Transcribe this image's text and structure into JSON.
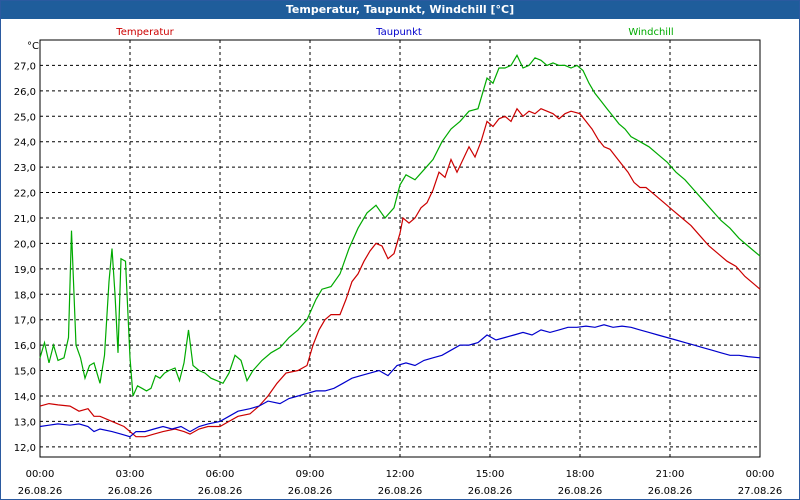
{
  "window": {
    "title": "Temperatur, Taupunkt, Windchill [°C]"
  },
  "chart_data": {
    "type": "line",
    "title": "Temperatur, Taupunkt, Windchill [°C]",
    "ylabel": "°C",
    "ylim": [
      11.6,
      28.0
    ],
    "xlim": [
      0,
      24
    ],
    "y_ticks": [
      "12,0",
      "13,0",
      "14,0",
      "15,0",
      "16,0",
      "17,0",
      "18,0",
      "19,0",
      "20,0",
      "21,0",
      "22,0",
      "23,0",
      "24,0",
      "25,0",
      "26,0",
      "27,0"
    ],
    "x_ticks": [
      {
        "time": "00:00",
        "date": "26.08.26",
        "h": 0
      },
      {
        "time": "03:00",
        "date": "26.08.26",
        "h": 3
      },
      {
        "time": "06:00",
        "date": "26.08.26",
        "h": 6
      },
      {
        "time": "09:00",
        "date": "26.08.26",
        "h": 9
      },
      {
        "time": "12:00",
        "date": "26.08.26",
        "h": 12
      },
      {
        "time": "15:00",
        "date": "26.08.26",
        "h": 15
      },
      {
        "time": "18:00",
        "date": "26.08.26",
        "h": 18
      },
      {
        "time": "21:00",
        "date": "26.08.26",
        "h": 21
      },
      {
        "time": "00:00",
        "date": "27.08.26",
        "h": 24
      }
    ],
    "grid": true,
    "series": [
      {
        "name": "Temperatur",
        "color": "#cc0000",
        "points": [
          [
            0,
            13.6
          ],
          [
            0.3,
            13.7
          ],
          [
            0.6,
            13.65
          ],
          [
            1.0,
            13.6
          ],
          [
            1.3,
            13.4
          ],
          [
            1.6,
            13.5
          ],
          [
            1.8,
            13.2
          ],
          [
            2.0,
            13.2
          ],
          [
            2.4,
            13.0
          ],
          [
            2.8,
            12.8
          ],
          [
            3.0,
            12.6
          ],
          [
            3.2,
            12.4
          ],
          [
            3.5,
            12.4
          ],
          [
            3.8,
            12.5
          ],
          [
            4.1,
            12.6
          ],
          [
            4.5,
            12.7
          ],
          [
            4.8,
            12.6
          ],
          [
            5.0,
            12.5
          ],
          [
            5.3,
            12.7
          ],
          [
            5.6,
            12.8
          ],
          [
            6.0,
            12.8
          ],
          [
            6.3,
            13.0
          ],
          [
            6.6,
            13.2
          ],
          [
            7.0,
            13.3
          ],
          [
            7.3,
            13.6
          ],
          [
            7.6,
            14.0
          ],
          [
            7.9,
            14.5
          ],
          [
            8.2,
            14.9
          ],
          [
            8.6,
            15.0
          ],
          [
            8.9,
            15.2
          ],
          [
            9.1,
            16.0
          ],
          [
            9.3,
            16.6
          ],
          [
            9.5,
            17.0
          ],
          [
            9.7,
            17.2
          ],
          [
            10.0,
            17.2
          ],
          [
            10.2,
            17.8
          ],
          [
            10.4,
            18.5
          ],
          [
            10.6,
            18.8
          ],
          [
            10.8,
            19.3
          ],
          [
            11.0,
            19.7
          ],
          [
            11.2,
            20.0
          ],
          [
            11.4,
            19.9
          ],
          [
            11.6,
            19.4
          ],
          [
            11.8,
            19.6
          ],
          [
            12.0,
            20.4
          ],
          [
            12.1,
            21.0
          ],
          [
            12.3,
            20.8
          ],
          [
            12.5,
            21.0
          ],
          [
            12.7,
            21.4
          ],
          [
            12.9,
            21.6
          ],
          [
            13.1,
            22.1
          ],
          [
            13.3,
            22.8
          ],
          [
            13.5,
            22.6
          ],
          [
            13.7,
            23.3
          ],
          [
            13.9,
            22.8
          ],
          [
            14.1,
            23.3
          ],
          [
            14.3,
            23.8
          ],
          [
            14.5,
            23.4
          ],
          [
            14.7,
            24.0
          ],
          [
            14.9,
            24.8
          ],
          [
            15.1,
            24.6
          ],
          [
            15.3,
            24.9
          ],
          [
            15.5,
            25.0
          ],
          [
            15.7,
            24.8
          ],
          [
            15.9,
            25.3
          ],
          [
            16.1,
            25.0
          ],
          [
            16.3,
            25.2
          ],
          [
            16.5,
            25.1
          ],
          [
            16.7,
            25.3
          ],
          [
            16.9,
            25.2
          ],
          [
            17.1,
            25.1
          ],
          [
            17.3,
            24.9
          ],
          [
            17.5,
            25.1
          ],
          [
            17.7,
            25.2
          ],
          [
            18.0,
            25.1
          ],
          [
            18.2,
            24.8
          ],
          [
            18.4,
            24.5
          ],
          [
            18.6,
            24.1
          ],
          [
            18.8,
            23.8
          ],
          [
            19.0,
            23.7
          ],
          [
            19.2,
            23.4
          ],
          [
            19.4,
            23.1
          ],
          [
            19.6,
            22.8
          ],
          [
            19.8,
            22.4
          ],
          [
            20.0,
            22.2
          ],
          [
            20.2,
            22.2
          ],
          [
            20.5,
            21.9
          ],
          [
            20.8,
            21.6
          ],
          [
            21.1,
            21.3
          ],
          [
            21.4,
            21.0
          ],
          [
            21.7,
            20.7
          ],
          [
            22.0,
            20.3
          ],
          [
            22.3,
            19.9
          ],
          [
            22.6,
            19.6
          ],
          [
            22.9,
            19.3
          ],
          [
            23.2,
            19.1
          ],
          [
            23.5,
            18.7
          ],
          [
            23.8,
            18.4
          ],
          [
            24.0,
            18.2
          ]
        ]
      },
      {
        "name": "Taupunkt",
        "color": "#0000cc",
        "points": [
          [
            0,
            12.8
          ],
          [
            0.3,
            12.85
          ],
          [
            0.6,
            12.9
          ],
          [
            1.0,
            12.85
          ],
          [
            1.3,
            12.9
          ],
          [
            1.6,
            12.8
          ],
          [
            1.8,
            12.6
          ],
          [
            2.0,
            12.7
          ],
          [
            2.4,
            12.6
          ],
          [
            2.7,
            12.5
          ],
          [
            3.0,
            12.4
          ],
          [
            3.2,
            12.6
          ],
          [
            3.5,
            12.6
          ],
          [
            3.8,
            12.7
          ],
          [
            4.1,
            12.8
          ],
          [
            4.4,
            12.7
          ],
          [
            4.7,
            12.8
          ],
          [
            5.0,
            12.6
          ],
          [
            5.3,
            12.8
          ],
          [
            5.6,
            12.9
          ],
          [
            6.0,
            13.0
          ],
          [
            6.3,
            13.2
          ],
          [
            6.6,
            13.4
          ],
          [
            7.0,
            13.5
          ],
          [
            7.3,
            13.6
          ],
          [
            7.6,
            13.8
          ],
          [
            8.0,
            13.7
          ],
          [
            8.3,
            13.9
          ],
          [
            8.6,
            14.0
          ],
          [
            8.9,
            14.1
          ],
          [
            9.2,
            14.2
          ],
          [
            9.5,
            14.2
          ],
          [
            9.8,
            14.3
          ],
          [
            10.1,
            14.5
          ],
          [
            10.4,
            14.7
          ],
          [
            10.7,
            14.8
          ],
          [
            11.0,
            14.9
          ],
          [
            11.3,
            15.0
          ],
          [
            11.6,
            14.8
          ],
          [
            11.9,
            15.2
          ],
          [
            12.2,
            15.3
          ],
          [
            12.5,
            15.2
          ],
          [
            12.8,
            15.4
          ],
          [
            13.1,
            15.5
          ],
          [
            13.4,
            15.6
          ],
          [
            13.7,
            15.8
          ],
          [
            14.0,
            16.0
          ],
          [
            14.3,
            16.0
          ],
          [
            14.6,
            16.1
          ],
          [
            14.9,
            16.4
          ],
          [
            15.2,
            16.2
          ],
          [
            15.5,
            16.3
          ],
          [
            15.8,
            16.4
          ],
          [
            16.1,
            16.5
          ],
          [
            16.4,
            16.4
          ],
          [
            16.7,
            16.6
          ],
          [
            17.0,
            16.5
          ],
          [
            17.3,
            16.6
          ],
          [
            17.6,
            16.7
          ],
          [
            17.9,
            16.7
          ],
          [
            18.2,
            16.75
          ],
          [
            18.5,
            16.7
          ],
          [
            18.8,
            16.8
          ],
          [
            19.1,
            16.7
          ],
          [
            19.4,
            16.75
          ],
          [
            19.7,
            16.7
          ],
          [
            20.0,
            16.6
          ],
          [
            20.3,
            16.5
          ],
          [
            20.6,
            16.4
          ],
          [
            20.9,
            16.3
          ],
          [
            21.2,
            16.2
          ],
          [
            21.5,
            16.1
          ],
          [
            21.8,
            16.0
          ],
          [
            22.1,
            15.9
          ],
          [
            22.4,
            15.8
          ],
          [
            22.7,
            15.7
          ],
          [
            23.0,
            15.6
          ],
          [
            23.3,
            15.6
          ],
          [
            23.6,
            15.55
          ],
          [
            24.0,
            15.5
          ]
        ]
      },
      {
        "name": "Windchill",
        "color": "#00aa00",
        "points": [
          [
            0,
            15.5
          ],
          [
            0.15,
            16.1
          ],
          [
            0.3,
            15.3
          ],
          [
            0.45,
            16.0
          ],
          [
            0.6,
            15.4
          ],
          [
            0.8,
            15.5
          ],
          [
            0.95,
            16.3
          ],
          [
            1.05,
            20.5
          ],
          [
            1.2,
            16.0
          ],
          [
            1.35,
            15.5
          ],
          [
            1.5,
            14.7
          ],
          [
            1.65,
            15.2
          ],
          [
            1.8,
            15.3
          ],
          [
            2.0,
            14.5
          ],
          [
            2.15,
            15.6
          ],
          [
            2.3,
            18.5
          ],
          [
            2.4,
            19.8
          ],
          [
            2.5,
            18.0
          ],
          [
            2.6,
            15.7
          ],
          [
            2.7,
            19.4
          ],
          [
            2.85,
            19.3
          ],
          [
            3.0,
            15.5
          ],
          [
            3.1,
            14.0
          ],
          [
            3.25,
            14.4
          ],
          [
            3.4,
            14.3
          ],
          [
            3.55,
            14.2
          ],
          [
            3.7,
            14.3
          ],
          [
            3.85,
            14.8
          ],
          [
            4.0,
            14.7
          ],
          [
            4.15,
            14.9
          ],
          [
            4.3,
            15.0
          ],
          [
            4.5,
            15.1
          ],
          [
            4.65,
            14.6
          ],
          [
            4.8,
            15.3
          ],
          [
            4.95,
            16.6
          ],
          [
            5.1,
            15.2
          ],
          [
            5.3,
            15.0
          ],
          [
            5.5,
            14.9
          ],
          [
            5.7,
            14.7
          ],
          [
            5.9,
            14.6
          ],
          [
            6.1,
            14.5
          ],
          [
            6.3,
            14.9
          ],
          [
            6.5,
            15.6
          ],
          [
            6.7,
            15.4
          ],
          [
            6.9,
            14.6
          ],
          [
            7.1,
            15.0
          ],
          [
            7.4,
            15.4
          ],
          [
            7.7,
            15.7
          ],
          [
            8.0,
            15.9
          ],
          [
            8.3,
            16.3
          ],
          [
            8.6,
            16.6
          ],
          [
            8.9,
            17.0
          ],
          [
            9.2,
            17.8
          ],
          [
            9.4,
            18.2
          ],
          [
            9.7,
            18.3
          ],
          [
            10.0,
            18.8
          ],
          [
            10.3,
            19.8
          ],
          [
            10.6,
            20.6
          ],
          [
            10.9,
            21.2
          ],
          [
            11.2,
            21.5
          ],
          [
            11.5,
            21.0
          ],
          [
            11.8,
            21.4
          ],
          [
            12.0,
            22.3
          ],
          [
            12.2,
            22.7
          ],
          [
            12.5,
            22.5
          ],
          [
            12.8,
            22.9
          ],
          [
            13.1,
            23.3
          ],
          [
            13.4,
            24.0
          ],
          [
            13.7,
            24.5
          ],
          [
            14.0,
            24.8
          ],
          [
            14.3,
            25.2
          ],
          [
            14.6,
            25.3
          ],
          [
            14.9,
            26.5
          ],
          [
            15.1,
            26.3
          ],
          [
            15.3,
            26.9
          ],
          [
            15.5,
            26.9
          ],
          [
            15.7,
            27.0
          ],
          [
            15.9,
            27.4
          ],
          [
            16.1,
            26.9
          ],
          [
            16.3,
            27.0
          ],
          [
            16.5,
            27.3
          ],
          [
            16.7,
            27.2
          ],
          [
            16.9,
            27.0
          ],
          [
            17.1,
            27.1
          ],
          [
            17.3,
            27.0
          ],
          [
            17.5,
            27.0
          ],
          [
            17.7,
            26.9
          ],
          [
            17.9,
            27.0
          ],
          [
            18.1,
            26.8
          ],
          [
            18.3,
            26.3
          ],
          [
            18.5,
            25.9
          ],
          [
            18.7,
            25.6
          ],
          [
            18.9,
            25.3
          ],
          [
            19.1,
            25.0
          ],
          [
            19.3,
            24.7
          ],
          [
            19.5,
            24.5
          ],
          [
            19.7,
            24.2
          ],
          [
            20.0,
            24.0
          ],
          [
            20.3,
            23.8
          ],
          [
            20.6,
            23.5
          ],
          [
            20.9,
            23.2
          ],
          [
            21.2,
            22.8
          ],
          [
            21.5,
            22.5
          ],
          [
            21.8,
            22.1
          ],
          [
            22.1,
            21.7
          ],
          [
            22.4,
            21.3
          ],
          [
            22.7,
            20.9
          ],
          [
            23.0,
            20.6
          ],
          [
            23.3,
            20.2
          ],
          [
            23.6,
            19.9
          ],
          [
            24.0,
            19.5
          ]
        ]
      }
    ]
  }
}
